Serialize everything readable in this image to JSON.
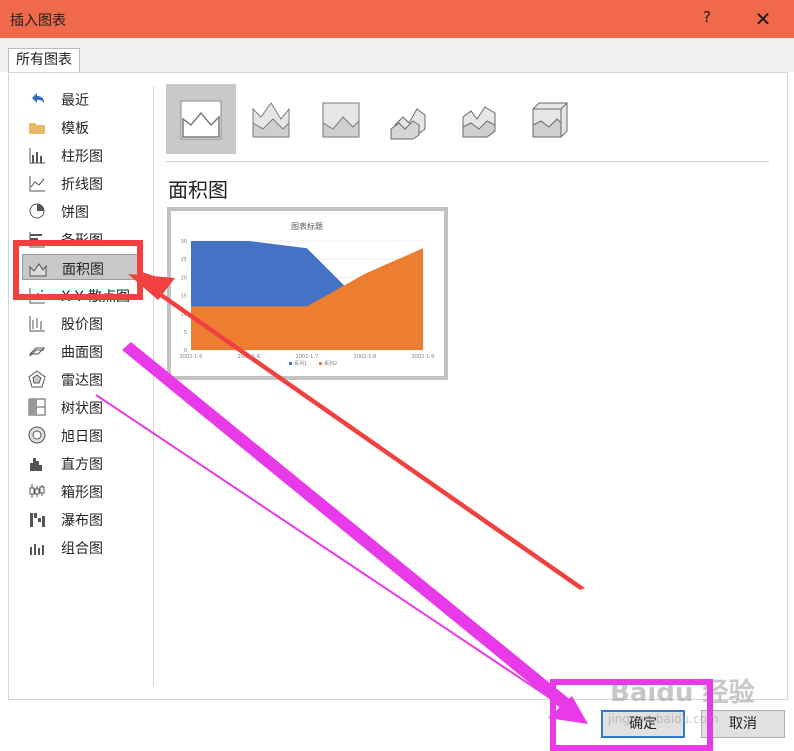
{
  "window": {
    "title": "插入图表",
    "help_label": "?",
    "close_label": "✕"
  },
  "tabs": [
    {
      "label": "所有图表"
    }
  ],
  "categories": [
    {
      "label": "最近",
      "icon": "recent-icon"
    },
    {
      "label": "模板",
      "icon": "folder-icon"
    },
    {
      "label": "柱形图",
      "icon": "column-chart-icon"
    },
    {
      "label": "折线图",
      "icon": "line-chart-icon"
    },
    {
      "label": "饼图",
      "icon": "pie-chart-icon"
    },
    {
      "label": "条形图",
      "icon": "bar-chart-icon"
    },
    {
      "label": "面积图",
      "icon": "area-chart-icon",
      "selected": true
    },
    {
      "label": "X Y 散点图",
      "icon": "scatter-chart-icon"
    },
    {
      "label": "股价图",
      "icon": "stock-chart-icon"
    },
    {
      "label": "曲面图",
      "icon": "surface-chart-icon"
    },
    {
      "label": "雷达图",
      "icon": "radar-chart-icon"
    },
    {
      "label": "树状图",
      "icon": "treemap-chart-icon"
    },
    {
      "label": "旭日图",
      "icon": "sunburst-chart-icon"
    },
    {
      "label": "直方图",
      "icon": "histogram-chart-icon"
    },
    {
      "label": "箱形图",
      "icon": "box-whisker-chart-icon"
    },
    {
      "label": "瀑布图",
      "icon": "waterfall-chart-icon"
    },
    {
      "label": "组合图",
      "icon": "combo-chart-icon"
    }
  ],
  "subtypes": [
    {
      "icon": "area-icon",
      "selected": true
    },
    {
      "icon": "stacked-area-icon"
    },
    {
      "icon": "100-percent-stacked-area-icon"
    },
    {
      "icon": "3d-area-icon"
    },
    {
      "icon": "3d-stacked-area-icon"
    },
    {
      "icon": "3d-100-percent-stacked-area-icon"
    }
  ],
  "heading": "面积图",
  "buttons": {
    "ok": "确定",
    "cancel": "取消"
  },
  "watermark": {
    "logo": "Baidu 经验",
    "url": "jingyan.baidu.com"
  },
  "colors": {
    "titlebar": "#f0694a",
    "series1": "#4472c4",
    "series2": "#ed7d31",
    "red_arrow": "#f04040",
    "magenta_arrow": "#e83ae8"
  },
  "chart_data": {
    "type": "area",
    "title": "图表标题",
    "categories": [
      "2002-1-5",
      "2002-1-6",
      "2002-1-7",
      "2002-1-8",
      "2002-1-9"
    ],
    "y_ticks": [
      "0",
      "5",
      "10",
      "15",
      "20",
      "25",
      "30"
    ],
    "ylim": [
      0,
      30
    ],
    "series": [
      {
        "name": "系列1",
        "values": [
          32,
          32,
          28,
          12,
          15
        ]
      },
      {
        "name": "系列2",
        "values": [
          12,
          12,
          12,
          21,
          28
        ]
      }
    ],
    "legend_position": "bottom"
  }
}
